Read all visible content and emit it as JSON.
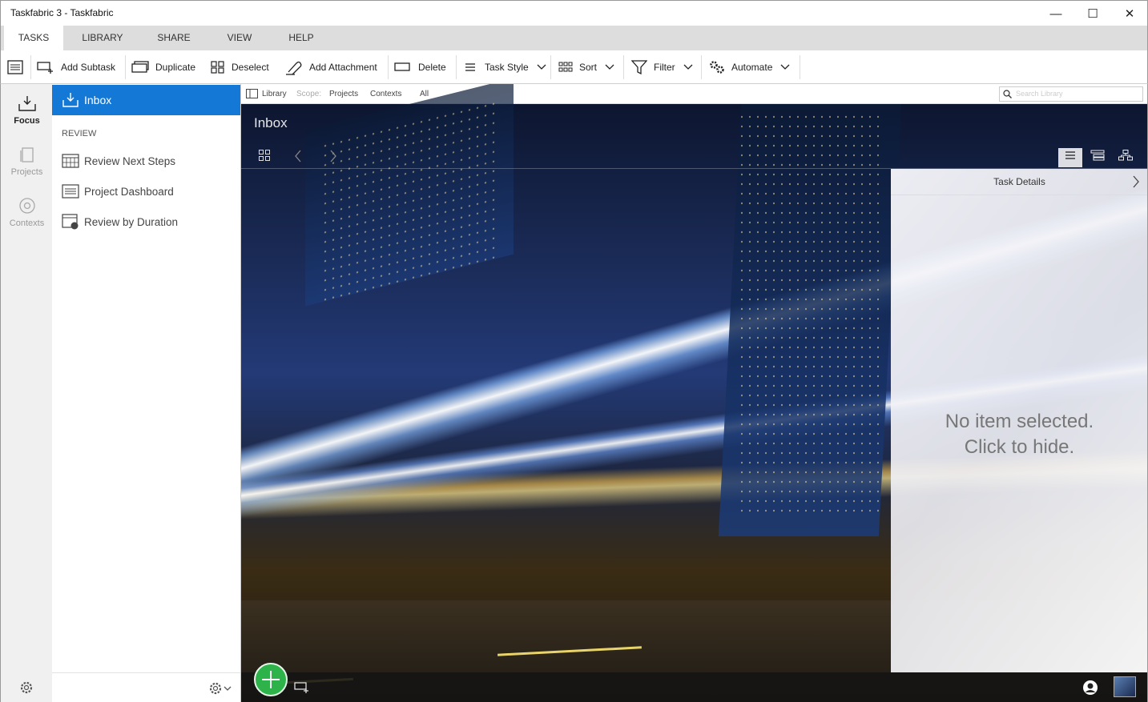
{
  "window": {
    "title": "Taskfabric 3 - Taskfabric",
    "minimize": "—",
    "maximize": "☐",
    "close": "✕"
  },
  "tabs": [
    {
      "label": "TASKS"
    },
    {
      "label": "LIBRARY"
    },
    {
      "label": "SHARE"
    },
    {
      "label": "VIEW"
    },
    {
      "label": "HELP"
    }
  ],
  "toolbar": {
    "add_subtask": "Add Subtask",
    "duplicate": "Duplicate",
    "deselect": "Deselect",
    "add_attachment": "Add Attachment",
    "delete": "Delete",
    "task_style": "Task Style",
    "sort": "Sort",
    "filter": "Filter",
    "automate": "Automate"
  },
  "rail": {
    "focus": "Focus",
    "projects": "Projects",
    "contexts": "Contexts"
  },
  "nav": {
    "inbox": "Inbox",
    "section_review": "REVIEW",
    "items": [
      {
        "label": "Review Next Steps"
      },
      {
        "label": "Project Dashboard"
      },
      {
        "label": "Review by Duration"
      }
    ]
  },
  "crumbbar": {
    "library": "Library",
    "scope": "Scope:",
    "projects": "Projects",
    "contexts": "Contexts",
    "all": "All",
    "search_placeholder": "Search Library"
  },
  "main": {
    "title": "Inbox"
  },
  "details": {
    "header": "Task Details",
    "empty_line1": "No item selected.",
    "empty_line2": "Click to hide."
  },
  "colors": {
    "accent": "#1479d6",
    "fab": "#2db34a"
  }
}
